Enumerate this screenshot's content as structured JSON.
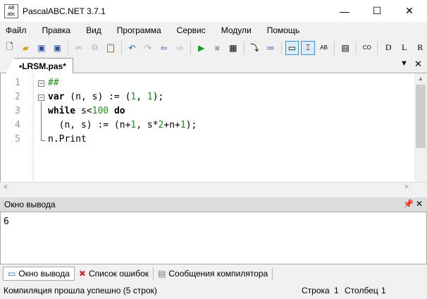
{
  "window": {
    "title": "PascalABC.NET 3.7.1",
    "logo": "AB abc"
  },
  "menu": [
    "Файл",
    "Правка",
    "Вид",
    "Программа",
    "Сервис",
    "Модули",
    "Помощь"
  ],
  "editor": {
    "tab": "•LRSM.pas*",
    "line_numbers": [
      "1",
      "2",
      "3",
      "4",
      "5"
    ]
  },
  "output": {
    "header": "Окно вывода",
    "text": "6"
  },
  "bottom_tabs": [
    "Окно вывода",
    "Список ошибок",
    "Сообщения компилятора"
  ],
  "status": {
    "message": "Компиляция прошла успешно (5 строк)",
    "row_label": "Строка",
    "row": "1",
    "col_label": "Столбец",
    "col": "1"
  }
}
